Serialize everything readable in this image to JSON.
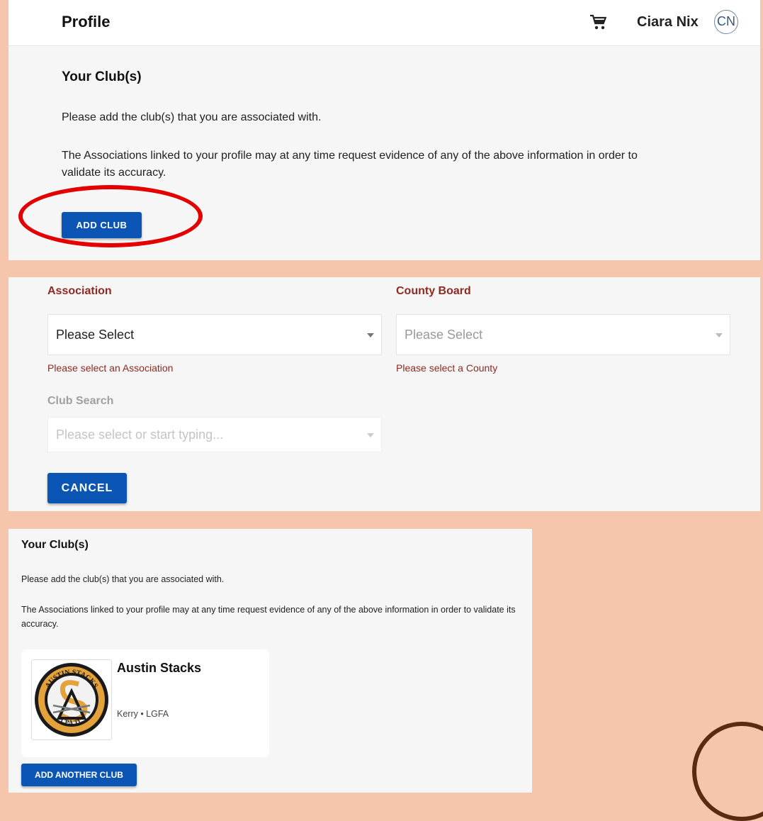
{
  "colors": {
    "background": "#f6c6ac",
    "panel": "#f6f6f6",
    "primary_button": "#0b55b5",
    "label_accent": "#8e2a22",
    "highlight_ring": "#e30000"
  },
  "header": {
    "title": "Profile",
    "cart_icon": "cart-icon",
    "user_name": "Ciara Nix",
    "avatar_initials": "CN"
  },
  "clubs_empty": {
    "heading": "Your Club(s)",
    "intro": "Please add the club(s) that you are associated with.",
    "notice": "The Associations linked to your profile may at any time request evidence of any of the above information in order to validate its accuracy.",
    "add_button": "ADD CLUB"
  },
  "add_form": {
    "association": {
      "label": "Association",
      "value": "Please Select",
      "error": "Please select an Association"
    },
    "county": {
      "label": "County Board",
      "value": "Please Select",
      "error": "Please select a County"
    },
    "club_search": {
      "label": "Club Search",
      "placeholder": "Please select or start typing..."
    },
    "cancel_button": "CANCEL"
  },
  "clubs_list": {
    "heading": "Your Club(s)",
    "intro": "Please add the club(s) that you are associated with.",
    "notice": "The Associations linked to your profile may at any time request evidence of any of the above information in order to validate its accuracy.",
    "clubs": [
      {
        "name": "Austin Stacks",
        "meta": "Kerry • LGFA",
        "logo_text_top": "AUSTIN STACKS",
        "logo_text_bottom": "CPÁ TL"
      }
    ],
    "add_another_button": "ADD ANOTHER CLUB"
  }
}
